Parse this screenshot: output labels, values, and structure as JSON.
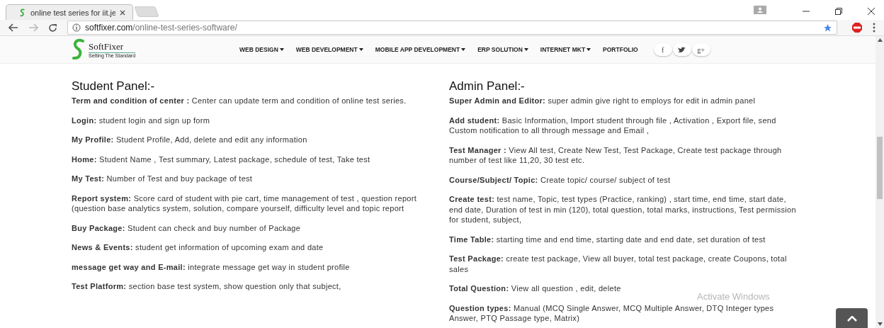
{
  "browser": {
    "tab": {
      "title": "online test series for iit.je"
    },
    "address": {
      "domain": "softfixer.com",
      "path": "/online-test-series-software/"
    }
  },
  "site": {
    "logo": {
      "name": "SoftFixer",
      "tagline": "Setting The Standard"
    },
    "nav": [
      {
        "label": "WEB DESIGN",
        "dropdown": true
      },
      {
        "label": "WEB DEVELOPMENT",
        "dropdown": true
      },
      {
        "label": "MOBILE APP DEVELOPMENT",
        "dropdown": true
      },
      {
        "label": "ERP SOLUTION",
        "dropdown": true
      },
      {
        "label": "INTERNET MKT",
        "dropdown": true
      },
      {
        "label": "PORTFOLIO",
        "dropdown": false
      }
    ],
    "social": [
      "f",
      "g+"
    ]
  },
  "panels": [
    {
      "title": "Student Panel:-",
      "items": [
        "**Term and condition of center :** Center can update term and condition of online test series.",
        "**Login:** student login and sign up form",
        "**My Profile:** Student Profile, Add, delete and edit any information",
        "**Home:** Student Name , Test summary, Latest package, schedule of test, Take test",
        "**My Test:** Number of Test and buy package of test",
        "**Report system:** Score card of student with pie cart, time management of test , question report (question base analytics system, solution, compare yourself, difficulty level and topic report",
        "**Buy Package:** Student can check and buy number of Package",
        "**News & Events:** student get information of upcoming exam and date",
        "**message get way and E-mail:** integrate message get way in student profile",
        "**Test Platform:** section base test system, show question only that subject,"
      ]
    },
    {
      "title": "Admin Panel:-",
      "items": [
        "**Super Admin and Editor:** super admin give right to employs for edit in admin panel",
        "**Add student:** Basic Information, Import student through file , Activation , Export file, send Custom notification to all through message and Email ,",
        "**Test Manager :** View All test, Create New Test, Test Package, Create test package through number of test like 11,20, 30 test etc.",
        "**Course/Subject/ Topic:** Create topic/ course/ subject of test",
        "**Create test:** test name, Topic, test types (Practice, ranking) , start time, end time, start date, end date, Duration of test in min (120), total question, total marks, instructions, Test permission for student, subject,",
        "**Time Table:** starting time and end time, starting date and end date, set duration of test",
        "**Test Package:** create test package, View all buyer, total test package, create Coupons, total sales",
        "**Total Question:** View all question , edit, delete",
        "**Question types:** Manual (MCQ Single Answer, MCQ Multiple Answer, DTQ Integer types Answer, PTQ Passage type, Matrix)"
      ]
    }
  ],
  "os_notice": {
    "title": "Activate Windows"
  }
}
